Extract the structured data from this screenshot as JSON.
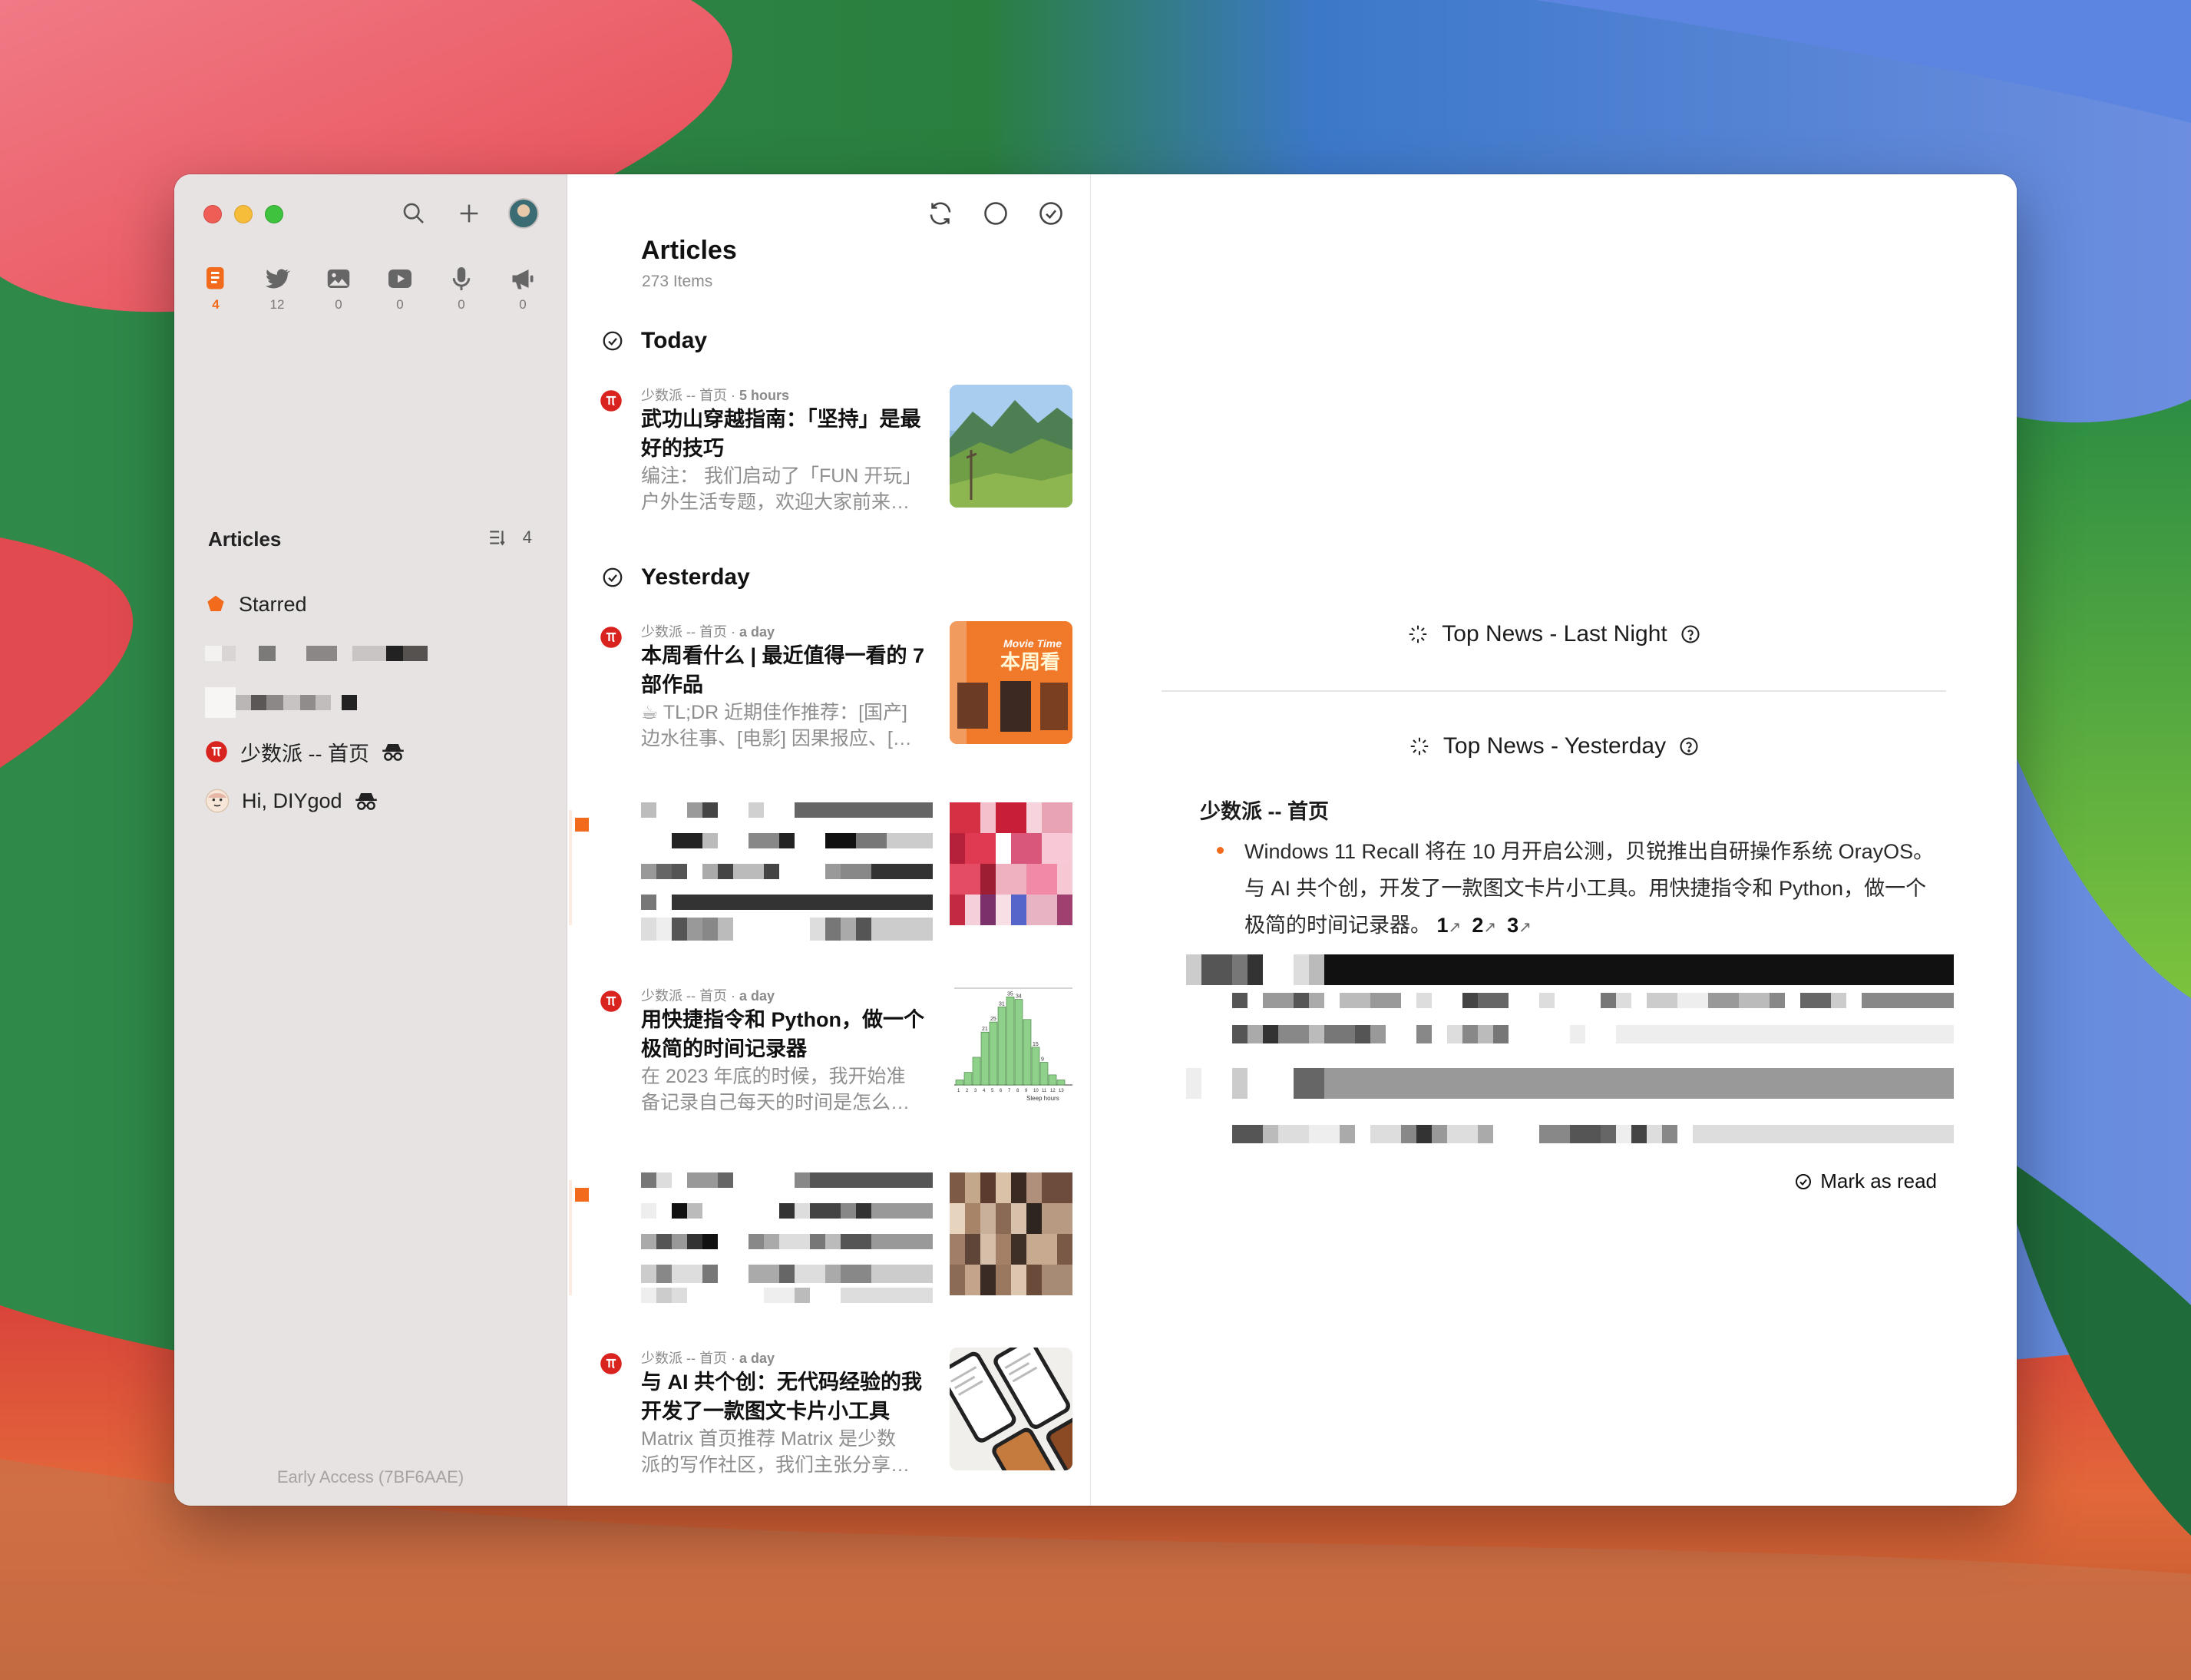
{
  "toolbar": {
    "search_icon": "search-icon",
    "add_icon": "plus-icon",
    "avatar": "avatar"
  },
  "views": [
    {
      "name": "articles",
      "count": "4",
      "active": true
    },
    {
      "name": "social",
      "count": "12"
    },
    {
      "name": "pictures",
      "count": "0"
    },
    {
      "name": "videos",
      "count": "0"
    },
    {
      "name": "audio",
      "count": "0"
    },
    {
      "name": "notifications",
      "count": "0"
    }
  ],
  "sidebar": {
    "section_title": "Articles",
    "section_count": "4",
    "items": [
      {
        "label": "Starred"
      },
      {
        "label": "少数派 -- 首页"
      },
      {
        "label": "Hi, DIYgod"
      }
    ],
    "footer": "Early Access (7BF6AAE)"
  },
  "list": {
    "title": "Articles",
    "count": "273 Items",
    "groups": {
      "today": "Today",
      "yesterday": "Yesterday"
    },
    "entries": [
      {
        "meta_source": "少数派 -- 首页",
        "meta_time": "5 hours",
        "title": "武功山穿越指南：「坚持」是最好的技巧",
        "summary_1": "编注：  我们启动了「FUN 开玩」",
        "summary_2": "户外生活专题，欢迎大家前来…"
      },
      {
        "meta_source": "少数派 -- 首页",
        "meta_time": "a day",
        "title": "本周看什么 | 最近值得一看的 7 部作品",
        "summary_1": "☕ TL;DR 近期佳作推荐：[国产]",
        "summary_2": "边水往事、[电影] 因果报应、[…",
        "thumb_text_1": "Movie Time",
        "thumb_text_2": "本周看"
      },
      {
        "meta_source": "少数派 -- 首页",
        "meta_time": "a day",
        "title": "用快捷指令和 Python，做一个极简的时间记录器",
        "summary_1": "在 2023 年底的时候，我开始准",
        "summary_2": "备记录自己每天的时间是怎么…",
        "thumb_chart_label": "Sleep hours"
      },
      {
        "meta_source": "少数派 -- 首页",
        "meta_time": "a day",
        "title": "与 AI 共个创：无代码经验的我开发了一款图文卡片小工具",
        "summary_1": "Matrix 首页推荐  Matrix 是少数",
        "summary_2": "派的写作社区，我们主张分享…"
      }
    ]
  },
  "reader": {
    "top_news_last_night": "Top News - Last Night",
    "top_news_yesterday": "Top News - Yesterday",
    "feed_name": "少数派 -- 首页",
    "news_text": "Windows 11 Recall 将在 10 月开启公测，贝锐推出自研操作系统 OrayOS。与 AI 共个创，开发了一款图文卡片小工具。用快捷指令和 Python，做一个极简的时间记录器。",
    "refs": [
      "1",
      "2",
      "3"
    ],
    "mark_as_read": "Mark as read"
  },
  "colors": {
    "accent": "#f26a1b",
    "sidebar_bg": "#e7e3e2",
    "source_icon": "#d8231f"
  },
  "thumb_chart_data": {
    "type": "bar",
    "xlabel": "Sleep hours",
    "values": [
      2,
      5,
      11,
      21,
      25,
      31,
      35,
      34,
      26,
      15,
      9,
      4,
      2
    ],
    "labels": [
      "",
      "",
      "",
      "21",
      "25",
      "31",
      "35",
      "34",
      "",
      "15",
      "9",
      "",
      ""
    ]
  }
}
